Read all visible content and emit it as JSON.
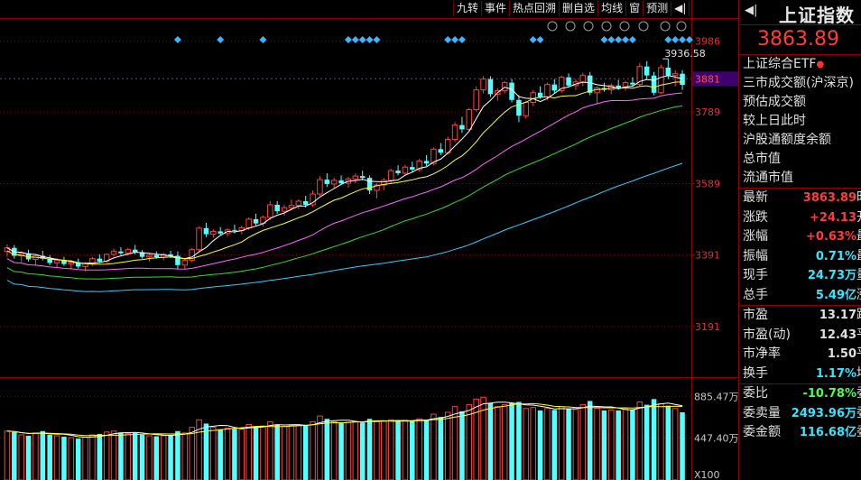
{
  "toolbar": [
    "九转",
    "事件",
    "热点回溯",
    "删自选",
    "均线",
    "窗",
    "预测"
  ],
  "price_axis": {
    "ticks": [
      {
        "label": "3986",
        "value": 3986
      },
      {
        "label": "3789",
        "value": 3789
      },
      {
        "label": "3589",
        "value": 3589
      },
      {
        "label": "3391",
        "value": 3391
      },
      {
        "label": "3191",
        "value": 3191
      }
    ],
    "current_label": "3881",
    "current_value": 3881,
    "high_annotation": "3936.58",
    "high_value": 3936.58
  },
  "volume_axis": {
    "ticks": [
      {
        "label": "885.47万",
        "value": 885.47
      },
      {
        "label": "447.40万",
        "value": 447.4
      }
    ],
    "unit": "X100"
  },
  "side": {
    "title": "上证指数",
    "price": "3863.89",
    "etf": "上证综合ETF",
    "info": [
      "三市成交额(沪深京)",
      "预估成交额",
      "较上日此时",
      "沪股通额度余额",
      "总市值",
      "流通市值"
    ],
    "stats1": [
      {
        "k": "最新",
        "v": "3863.89",
        "u": "时",
        "c": "red"
      },
      {
        "k": "涨跌",
        "v": "+24.13",
        "u": "开",
        "c": "red"
      },
      {
        "k": "涨幅",
        "v": "+0.63%",
        "u": "最",
        "c": "red"
      },
      {
        "k": "振幅",
        "v": "0.71%",
        "u": "最",
        "c": "cyan"
      },
      {
        "k": "现手",
        "v": "24.73万",
        "u": "量",
        "c": "cyan"
      },
      {
        "k": "总手",
        "v": "5.49亿",
        "u": "涨",
        "c": "cyan"
      }
    ],
    "stats2": [
      {
        "k": "市盈",
        "v": "13.17",
        "u": "跌",
        "c": "plain"
      },
      {
        "k": "市盈(动)",
        "v": "12.43",
        "u": "平",
        "c": "plain"
      },
      {
        "k": "市净率",
        "v": "1.50",
        "u": "平",
        "c": "plain"
      },
      {
        "k": "换手",
        "v": "1.17%",
        "u": "均",
        "c": "cyan"
      }
    ],
    "stats3": [
      {
        "k": "委比",
        "v": "-10.78%",
        "u": "委",
        "c": "grn"
      },
      {
        "k": "委卖量",
        "v": "2493.96万",
        "u": "委",
        "c": "cyan"
      },
      {
        "k": "委金额",
        "v": "116.68亿",
        "u": "委",
        "c": "cyan"
      }
    ]
  },
  "chart_data": {
    "type": "candlestick",
    "ylim": [
      3050,
      4050
    ],
    "volume_ylim": [
      0,
      940
    ],
    "candles": [
      [
        3400,
        3420,
        3385,
        3410,
        520
      ],
      [
        3410,
        3418,
        3380,
        3388,
        510
      ],
      [
        3388,
        3400,
        3370,
        3395,
        480
      ],
      [
        3395,
        3405,
        3372,
        3378,
        470
      ],
      [
        3378,
        3392,
        3360,
        3388,
        500
      ],
      [
        3388,
        3402,
        3375,
        3380,
        520
      ],
      [
        3380,
        3390,
        3362,
        3368,
        480
      ],
      [
        3368,
        3382,
        3355,
        3376,
        470
      ],
      [
        3376,
        3385,
        3360,
        3365,
        460
      ],
      [
        3365,
        3376,
        3350,
        3370,
        450
      ],
      [
        3370,
        3380,
        3352,
        3358,
        440
      ],
      [
        3358,
        3370,
        3345,
        3366,
        455
      ],
      [
        3366,
        3384,
        3360,
        3380,
        480
      ],
      [
        3380,
        3392,
        3368,
        3372,
        490
      ],
      [
        3372,
        3395,
        3368,
        3392,
        510
      ],
      [
        3392,
        3408,
        3385,
        3400,
        520
      ],
      [
        3400,
        3412,
        3390,
        3395,
        505
      ],
      [
        3395,
        3410,
        3388,
        3405,
        495
      ],
      [
        3405,
        3418,
        3392,
        3398,
        500
      ],
      [
        3398,
        3404,
        3380,
        3385,
        480
      ],
      [
        3385,
        3395,
        3372,
        3390,
        470
      ],
      [
        3390,
        3400,
        3380,
        3384,
        465
      ],
      [
        3384,
        3396,
        3375,
        3392,
        470
      ],
      [
        3392,
        3402,
        3382,
        3388,
        480
      ],
      [
        3388,
        3400,
        3350,
        3362,
        520
      ],
      [
        3362,
        3380,
        3350,
        3375,
        500
      ],
      [
        3375,
        3410,
        3370,
        3405,
        560
      ],
      [
        3405,
        3470,
        3400,
        3465,
        640
      ],
      [
        3465,
        3480,
        3440,
        3448,
        600
      ],
      [
        3448,
        3462,
        3438,
        3456,
        560
      ],
      [
        3456,
        3468,
        3445,
        3450,
        540
      ],
      [
        3450,
        3465,
        3442,
        3460,
        550
      ],
      [
        3460,
        3475,
        3450,
        3458,
        545
      ],
      [
        3458,
        3472,
        3448,
        3466,
        540
      ],
      [
        3466,
        3495,
        3460,
        3490,
        590
      ],
      [
        3490,
        3505,
        3472,
        3478,
        570
      ],
      [
        3478,
        3500,
        3470,
        3495,
        575
      ],
      [
        3495,
        3540,
        3488,
        3530,
        620
      ],
      [
        3530,
        3540,
        3505,
        3512,
        590
      ],
      [
        3512,
        3530,
        3500,
        3522,
        570
      ],
      [
        3522,
        3545,
        3515,
        3528,
        580
      ],
      [
        3528,
        3545,
        3518,
        3540,
        585
      ],
      [
        3540,
        3555,
        3522,
        3530,
        580
      ],
      [
        3530,
        3570,
        3525,
        3560,
        620
      ],
      [
        3560,
        3610,
        3555,
        3600,
        680
      ],
      [
        3600,
        3618,
        3580,
        3588,
        650
      ],
      [
        3588,
        3605,
        3575,
        3598,
        620
      ],
      [
        3598,
        3612,
        3585,
        3590,
        610
      ],
      [
        3590,
        3608,
        3578,
        3602,
        615
      ],
      [
        3602,
        3618,
        3590,
        3610,
        620
      ],
      [
        3610,
        3625,
        3598,
        3605,
        610
      ],
      [
        3605,
        3612,
        3560,
        3570,
        650
      ],
      [
        3570,
        3590,
        3548,
        3585,
        620
      ],
      [
        3585,
        3605,
        3570,
        3598,
        625
      ],
      [
        3598,
        3630,
        3590,
        3625,
        640
      ],
      [
        3625,
        3640,
        3612,
        3618,
        630
      ],
      [
        3618,
        3642,
        3610,
        3635,
        635
      ],
      [
        3635,
        3650,
        3620,
        3628,
        630
      ],
      [
        3628,
        3658,
        3622,
        3652,
        650
      ],
      [
        3652,
        3668,
        3638,
        3645,
        640
      ],
      [
        3645,
        3690,
        3640,
        3685,
        700
      ],
      [
        3685,
        3702,
        3668,
        3675,
        670
      ],
      [
        3675,
        3720,
        3670,
        3712,
        720
      ],
      [
        3712,
        3760,
        3705,
        3752,
        780
      ],
      [
        3752,
        3775,
        3730,
        3740,
        730
      ],
      [
        3740,
        3800,
        3735,
        3795,
        800
      ],
      [
        3795,
        3860,
        3790,
        3850,
        860
      ],
      [
        3850,
        3888,
        3840,
        3880,
        880
      ],
      [
        3880,
        3888,
        3830,
        3838,
        820
      ],
      [
        3838,
        3855,
        3820,
        3848,
        780
      ],
      [
        3848,
        3875,
        3840,
        3870,
        800
      ],
      [
        3870,
        3880,
        3815,
        3822,
        820
      ],
      [
        3822,
        3835,
        3760,
        3778,
        830
      ],
      [
        3778,
        3820,
        3770,
        3815,
        760
      ],
      [
        3815,
        3850,
        3805,
        3842,
        770
      ],
      [
        3842,
        3860,
        3825,
        3830,
        740
      ],
      [
        3830,
        3870,
        3822,
        3865,
        760
      ],
      [
        3865,
        3880,
        3840,
        3848,
        745
      ],
      [
        3848,
        3890,
        3842,
        3885,
        780
      ],
      [
        3885,
        3896,
        3858,
        3862,
        760
      ],
      [
        3862,
        3880,
        3850,
        3872,
        750
      ],
      [
        3872,
        3898,
        3860,
        3890,
        800
      ],
      [
        3890,
        3900,
        3835,
        3842,
        840
      ],
      [
        3842,
        3860,
        3810,
        3855,
        760
      ],
      [
        3855,
        3870,
        3845,
        3850,
        740
      ],
      [
        3850,
        3868,
        3838,
        3862,
        745
      ],
      [
        3862,
        3878,
        3850,
        3855,
        740
      ],
      [
        3855,
        3875,
        3848,
        3870,
        755
      ],
      [
        3870,
        3885,
        3858,
        3865,
        750
      ],
      [
        3865,
        3925,
        3860,
        3915,
        830
      ],
      [
        3915,
        3930,
        3880,
        3890,
        800
      ],
      [
        3890,
        3900,
        3835,
        3842,
        860
      ],
      [
        3842,
        3920,
        3838,
        3912,
        810
      ],
      [
        3912,
        3936.58,
        3880,
        3890,
        790
      ],
      [
        3890,
        3905,
        3860,
        3895,
        760
      ],
      [
        3895,
        3905,
        3850,
        3863.89,
        720
      ]
    ],
    "ma_colors": [
      "#ffffff",
      "#ffff33",
      "#ff66ff",
      "#33dd33",
      "#33ccff"
    ],
    "up_color": "#ff4040",
    "down_color": "#54ffff",
    "event_markers_at": [
      24,
      30,
      36,
      48,
      49,
      50,
      51,
      52,
      62,
      63,
      64,
      74,
      75,
      84,
      85,
      86,
      87,
      88,
      93,
      94,
      95,
      96
    ]
  }
}
